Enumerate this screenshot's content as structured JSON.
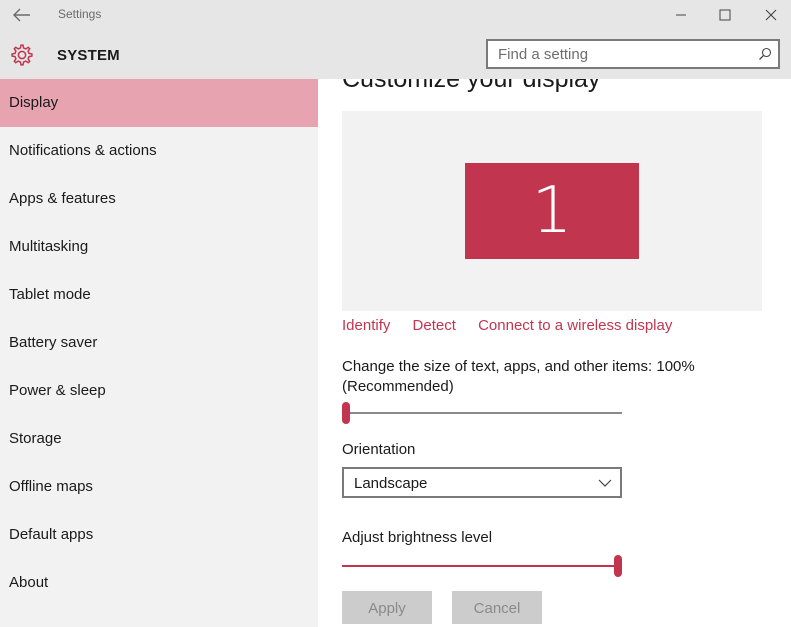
{
  "window": {
    "title": "Settings",
    "controls": {
      "minimize": "minimize-icon",
      "maximize": "maximize-icon",
      "close": "close-icon"
    }
  },
  "header": {
    "section_icon": "gear-icon",
    "section_title": "SYSTEM",
    "search": {
      "placeholder": "Find a setting",
      "icon": "search-icon"
    }
  },
  "sidebar": {
    "items": [
      {
        "label": "Display",
        "active": true
      },
      {
        "label": "Notifications & actions"
      },
      {
        "label": "Apps & features"
      },
      {
        "label": "Multitasking"
      },
      {
        "label": "Tablet mode"
      },
      {
        "label": "Battery saver"
      },
      {
        "label": "Power & sleep"
      },
      {
        "label": "Storage"
      },
      {
        "label": "Offline maps"
      },
      {
        "label": "Default apps"
      },
      {
        "label": "About"
      }
    ]
  },
  "main": {
    "heading": "Customize your display",
    "monitor_label": "1",
    "links": {
      "identify": "Identify",
      "detect": "Detect",
      "connect": "Connect to a wireless display"
    },
    "scale_label": "Change the size of text, apps, and other items: 100% (Recommended)",
    "scale_value": 0,
    "orientation_label": "Orientation",
    "orientation_value": "Landscape",
    "brightness_label": "Adjust brightness level",
    "brightness_value": 1.0,
    "apply_label": "Apply",
    "cancel_label": "Cancel"
  },
  "colors": {
    "accent": "#c1354f",
    "sidebar_active": "#e8a3b0",
    "sidebar_bg": "#f2f2f2",
    "header_bg": "#e6e6e6"
  }
}
